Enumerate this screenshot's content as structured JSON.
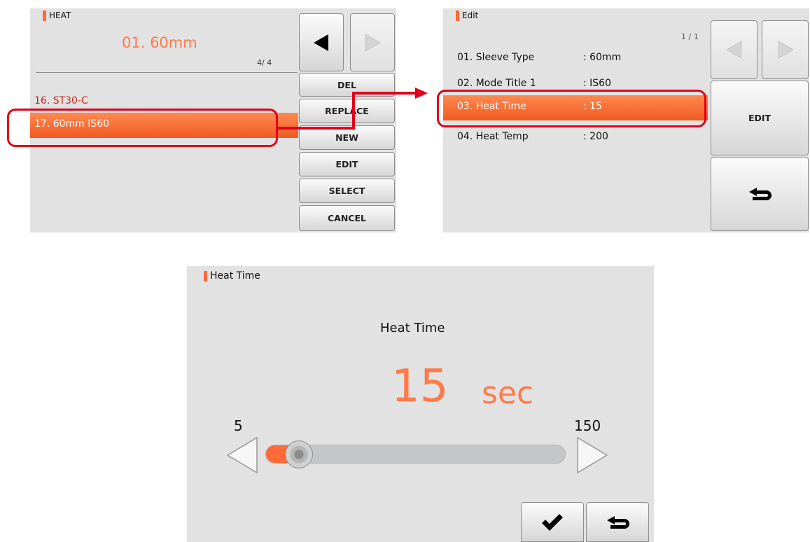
{
  "screen1": {
    "header": "HEAT",
    "current": "01. 60mm",
    "page_indicator": "4/ 4",
    "list": [
      "16. ST30-C",
      "17. 60mm IS60"
    ],
    "buttons": [
      "DEL",
      "REPLACE",
      "NEW",
      "EDIT",
      "SELECT",
      "CANCEL"
    ]
  },
  "screen2": {
    "header": "Edit",
    "page_indicator": "1 / 1",
    "rows": [
      {
        "label": "01.  Sleeve Type",
        "value": ": 60mm"
      },
      {
        "label": "02.  Mode Title 1",
        "value": ": IS60"
      },
      {
        "label": "03.  Heat Time",
        "value": ": 15"
      },
      {
        "label": "04.  Heat Temp",
        "value": ": 200"
      }
    ],
    "edit_button": "EDIT"
  },
  "screen3": {
    "header": "Heat Time",
    "title": "Heat Time",
    "value": "15",
    "unit": "sec",
    "min": "5",
    "max": "150",
    "slider_fraction": 0.07
  },
  "colors": {
    "accent": "#ff6a38",
    "highlight": "#f26a30",
    "annotation": "#e1001a",
    "panel": "#e2e2e2"
  },
  "icons": [
    "triangle-left-icon",
    "triangle-right-icon",
    "return-icon",
    "check-icon"
  ]
}
